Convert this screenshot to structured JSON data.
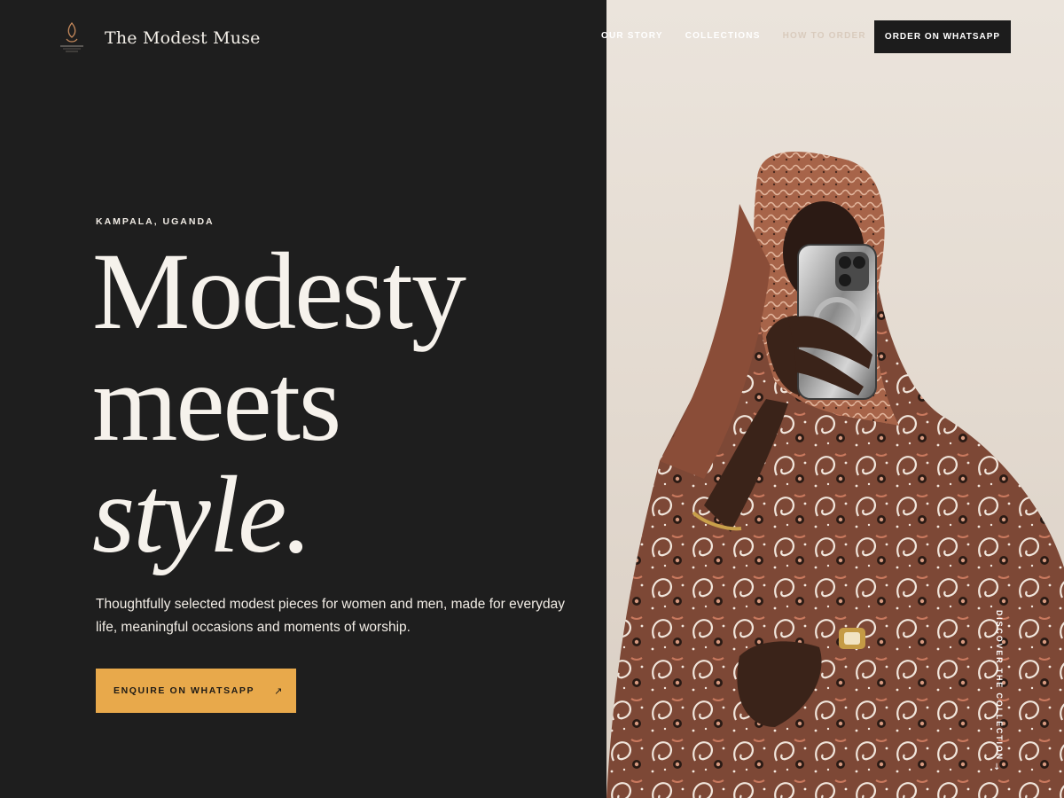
{
  "brand": {
    "name": "The Modest Muse",
    "logo_icon": "modest-muse-logo-icon"
  },
  "nav": {
    "items": [
      {
        "label": "OUR STORY"
      },
      {
        "label": "COLLECTIONS"
      },
      {
        "label": "HOW TO ORDER"
      }
    ],
    "order_button": "ORDER ON WHATSAPP"
  },
  "hero": {
    "eyebrow": "KAMPALA, UGANDA",
    "headline": {
      "line1": "Modesty",
      "line2": "meets",
      "line3": "style."
    },
    "lede": "Thoughtfully selected modest pieces for women and men, made for everyday life, meaningful occasions and moments of worship.",
    "cta_label": "ENQUIRE ON WHATSAPP",
    "cta_icon": "arrow-up-right-icon",
    "scroll_cue": "DISCOVER THE COLLECTION",
    "scroll_icon": "arrow-down-icon"
  },
  "colors": {
    "background_dark": "#1e1e1e",
    "accent": "#e8a94b",
    "text_light": "#f6f2ec",
    "photo_backdrop": "#e6ddd3"
  }
}
